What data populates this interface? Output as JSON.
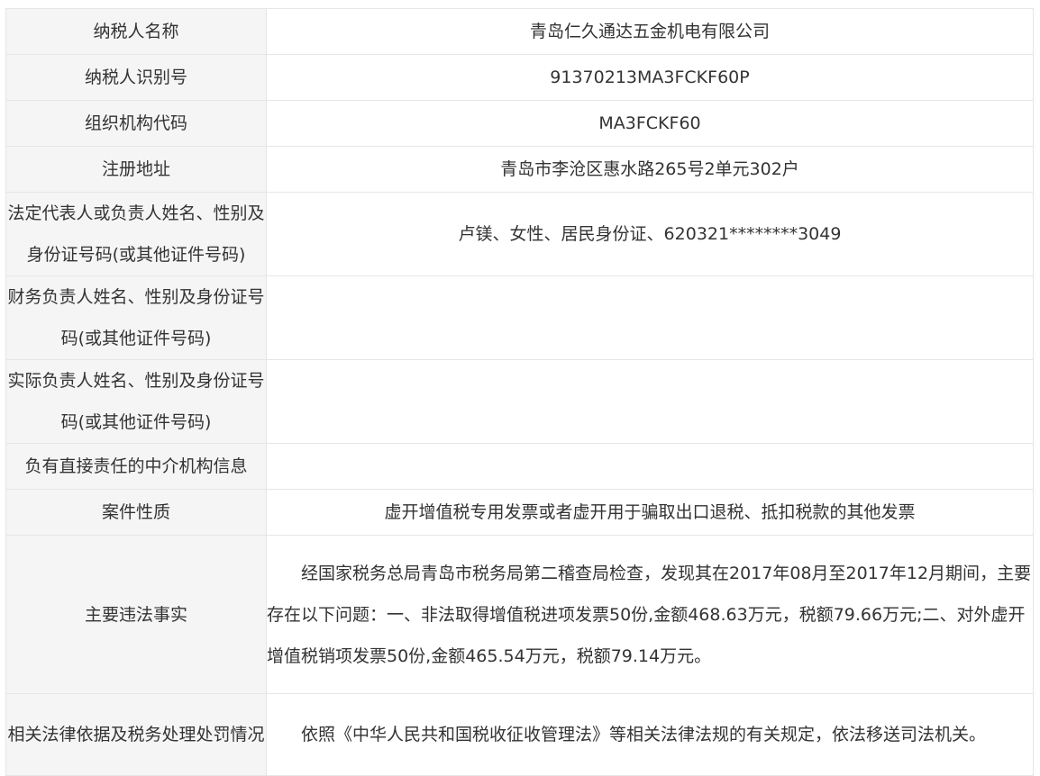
{
  "rows": [
    {
      "label": "纳税人名称",
      "value": "青岛仁久通达五金机电有限公司"
    },
    {
      "label": "纳税人识别号",
      "value": "91370213MA3FCKF60P"
    },
    {
      "label": "组织机构代码",
      "value": "MA3FCKF60"
    },
    {
      "label": "注册地址",
      "value": "青岛市李沧区惠水路265号2单元302户"
    },
    {
      "label": "法定代表人或负责人姓名、性别及身份证号码(或其他证件号码)",
      "value": "卢镁、女性、居民身份证、620321********3049"
    },
    {
      "label": "财务负责人姓名、性别及身份证号码(或其他证件号码)",
      "value": ""
    },
    {
      "label": "实际负责人姓名、性别及身份证号码(或其他证件号码)",
      "value": ""
    },
    {
      "label": "负有直接责任的中介机构信息",
      "value": ""
    },
    {
      "label": "案件性质",
      "value": "虚开增值税专用发票或者虚开用于骗取出口退税、抵扣税款的其他发票"
    },
    {
      "label": "主要违法事实",
      "value": "经国家税务总局青岛市税务局第二稽查局检查，发现其在2017年08月至2017年12月期间，主要存在以下问题：一、非法取得增值税进项发票50份,金额468.63万元，税额79.66万元;二、对外虚开增值税销项发票50份,金额465.54万元，税额79.14万元。"
    },
    {
      "label": "相关法律依据及税务处理处罚情况",
      "value": "依照《中华人民共和国税收征收管理法》等相关法律法规的有关规定，依法移送司法机关。"
    }
  ]
}
